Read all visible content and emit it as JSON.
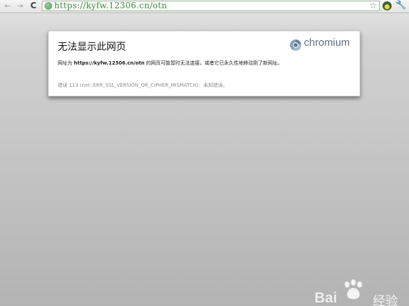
{
  "toolbar": {
    "back_icon": "←",
    "forward_icon": "→",
    "reload_icon": "C",
    "url": "https://kyfw.12306.cn/otn",
    "star_icon": "☆",
    "wrench_icon": "🔧"
  },
  "error_card": {
    "title": "无法显示此网页",
    "brand": "chromium",
    "desc_prefix": "网址为 ",
    "desc_url": "https://kyfw.12306.cn/otn",
    "desc_suffix": " 的网页可能暂时无法连接，或者它已永久性地移动到了新网址。",
    "error_code": "错误 113 (net::ERR_SSL_VERSION_OR_CIPHER_MISMATCH)：未知错误。"
  },
  "watermark": {
    "text": "Bai",
    "suffix": "经验"
  },
  "colors": {
    "url_green": "#3a8a3a",
    "brand_gray": "#5f6f80",
    "background_top": "#e7e7e7",
    "background_bottom": "#b3b3b3"
  }
}
